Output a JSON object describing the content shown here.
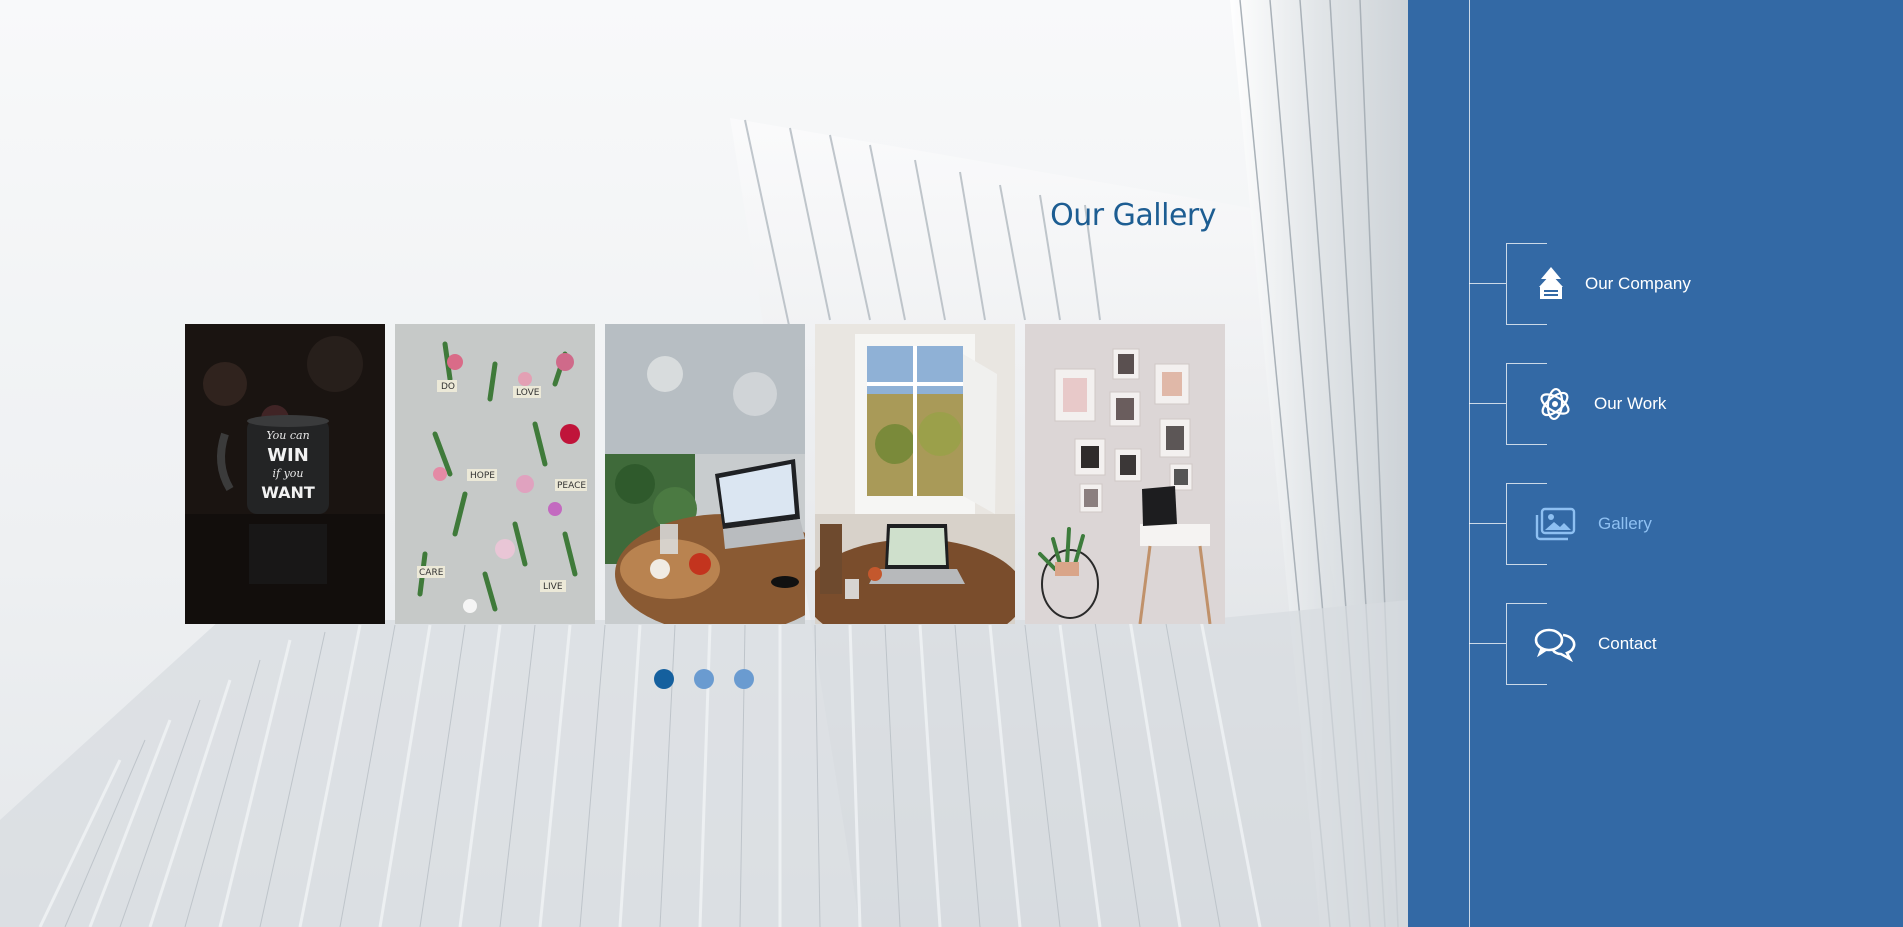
{
  "gallery": {
    "title": "Our Gallery",
    "photos": [
      {
        "name": "photo-mug",
        "text": [
          "You can",
          "WIN",
          "if you",
          "WANT"
        ]
      },
      {
        "name": "photo-flowers",
        "text": [
          "DO",
          "LOVE",
          "HOPE",
          "PEACE",
          "CARE",
          "LIVE"
        ]
      },
      {
        "name": "photo-cafe-table"
      },
      {
        "name": "photo-window-laptop"
      },
      {
        "name": "photo-frames-wall"
      }
    ],
    "pager": {
      "pages": 3,
      "active": 1
    }
  },
  "sidebar": {
    "items": [
      {
        "label": "Our Company",
        "icon": "company-icon",
        "current": false
      },
      {
        "label": "Our Work",
        "icon": "work-icon",
        "current": false
      },
      {
        "label": "Gallery",
        "icon": "gallery-icon",
        "current": true
      },
      {
        "label": "Contact",
        "icon": "contact-icon",
        "current": false
      }
    ]
  },
  "colors": {
    "sidebar": "#3369a5",
    "title": "#1d5d92",
    "active_dot": "#15609e",
    "inactive_dot": "#6a9bd0",
    "current_nav": "#8ec0f2"
  }
}
